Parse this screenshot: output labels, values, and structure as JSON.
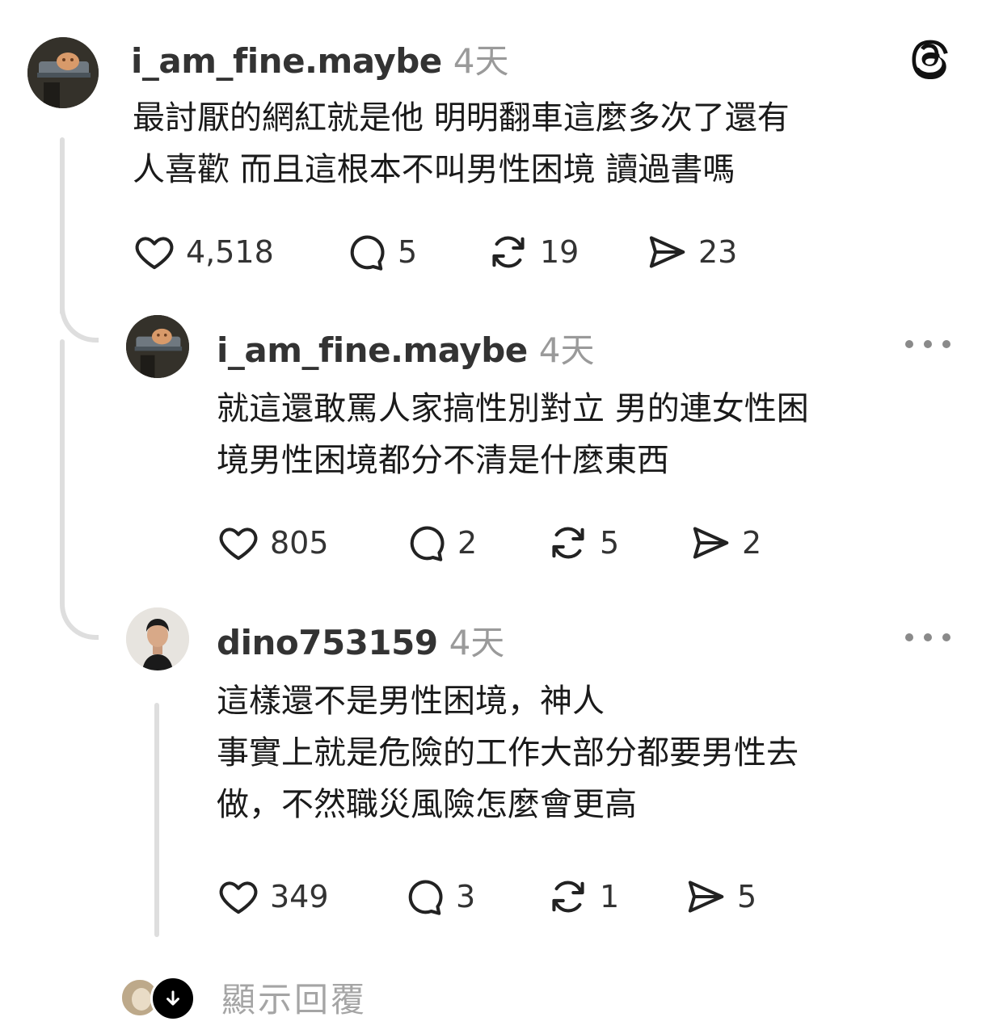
{
  "posts": [
    {
      "username": "i_am_fine.maybe",
      "time": "4天",
      "text": "最討厭的網紅就是他 明明翻車這麼多次了還有\n人喜歡 而且這根本不叫男性困境 讀過書嗎",
      "likes": "4,518",
      "replies": "5",
      "reposts": "19",
      "shares": "23",
      "avatar_icon": "cat-on-tray-avatar"
    },
    {
      "username": "i_am_fine.maybe",
      "time": "4天",
      "text": "就這還敢罵人家搞性別對立 男的連女性困\n境男性困境都分不清是什麼東西",
      "likes": "805",
      "replies": "2",
      "reposts": "5",
      "shares": "2",
      "avatar_icon": "cat-on-tray-avatar"
    },
    {
      "username": "dino753159",
      "time": "4天",
      "text": "這樣還不是男性困境，神人\n事實上就是危險的工作大部分都要男性去\n做，不然職災風險怎麼會更高",
      "likes": "349",
      "replies": "3",
      "reposts": "1",
      "shares": "5",
      "avatar_icon": "man-portrait-avatar"
    }
  ],
  "footer": {
    "show_replies": "顯示回覆"
  },
  "app_logo_icon": "threads-logo-icon"
}
